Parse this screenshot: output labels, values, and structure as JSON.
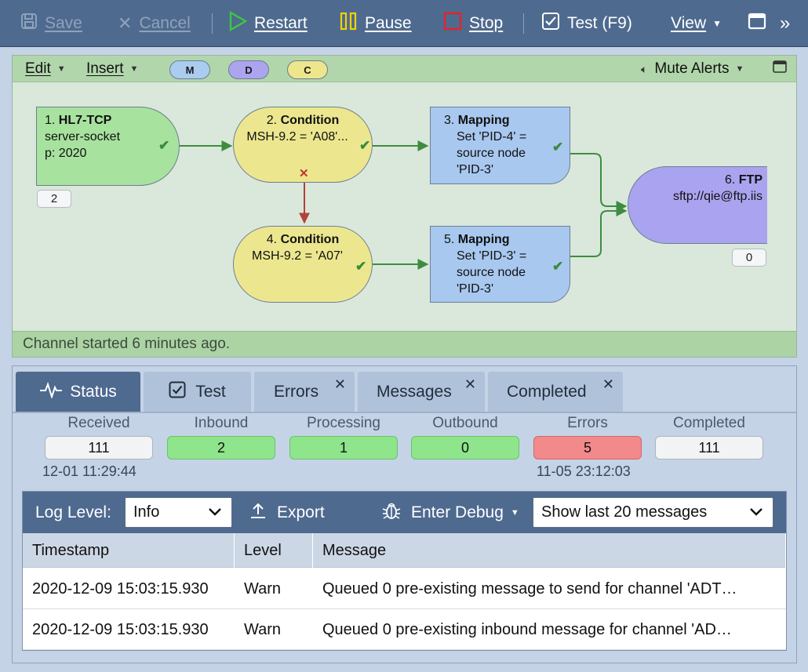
{
  "toolbar": {
    "save": "Save",
    "cancel": "Cancel",
    "restart": "Restart",
    "pause": "Pause",
    "stop": "Stop",
    "test": "Test (F9)",
    "view": "View",
    "icons": {
      "save": "floppy-icon",
      "cancel": "x-icon",
      "restart": "play-icon",
      "pause": "pause-icon",
      "stop": "stop-square-icon",
      "test": "checkbox-icon",
      "window": "window-icon",
      "more": "double-chevron-icon"
    }
  },
  "canvas": {
    "menu_edit": "Edit",
    "menu_insert": "Insert",
    "pills": [
      "M",
      "D",
      "C"
    ],
    "mute_alerts": "Mute Alerts",
    "status_text": "Channel started 6 minutes ago.",
    "nodes": [
      {
        "num": "1.",
        "title": "HL7-TCP",
        "line1": "server-socket",
        "line2": "p: 2020",
        "line3": "",
        "count": "2"
      },
      {
        "num": "2.",
        "title": "Condition",
        "line1": "MSH-9.2 = 'A08'...",
        "line2": "",
        "line3": ""
      },
      {
        "num": "3.",
        "title": "Mapping",
        "line1": "Set 'PID-4' =",
        "line2": "source node",
        "line3": "'PID-3'"
      },
      {
        "num": "4.",
        "title": "Condition",
        "line1": "MSH-9.2 = 'A07'",
        "line2": "",
        "line3": ""
      },
      {
        "num": "5.",
        "title": "Mapping",
        "line1": "Set 'PID-3' =",
        "line2": "source node",
        "line3": "'PID-3'"
      },
      {
        "num": "6.",
        "title": "FTP",
        "line1": "sftp://qie@ftp.iis",
        "line2": "",
        "line3": "",
        "count": "0"
      }
    ],
    "colors": {
      "green": "#a7e29e",
      "yellow": "#ece78f",
      "blue": "#a8c8ef",
      "purple": "#aaa3ef",
      "edge_ok": "#3f8c40",
      "edge_fail": "#b2413a"
    }
  },
  "tabs": [
    {
      "label": "Status",
      "icon": "pulse-icon",
      "active": true
    },
    {
      "label": "Test",
      "icon": "checkbox-icon"
    },
    {
      "label": "Errors",
      "close": "✕"
    },
    {
      "label": "Messages",
      "close": "✕"
    },
    {
      "label": "Completed",
      "close": "✕"
    }
  ],
  "stats": [
    {
      "label": "Received",
      "value": "111",
      "time": "12-01 11:29:44",
      "color": "#f2f3f4"
    },
    {
      "label": "Inbound",
      "value": "2",
      "color": "#8ee58c"
    },
    {
      "label": "Processing",
      "value": "1",
      "color": "#8ee58c"
    },
    {
      "label": "Outbound",
      "value": "0",
      "color": "#8ee58c"
    },
    {
      "label": "Errors",
      "value": "5",
      "time": "11-05 23:12:03",
      "color": "#f2898a"
    },
    {
      "label": "Completed",
      "value": "111",
      "color": "#f2f3f4"
    }
  ],
  "log": {
    "level_label": "Log Level:",
    "level_value": "Info",
    "export": "Export",
    "debug": "Enter Debug",
    "show_value": "Show last 20 messages",
    "columns": [
      "Timestamp",
      "Level",
      "Message"
    ],
    "rows": [
      {
        "timestamp": "2020-12-09 15:03:15.930",
        "level": "Warn",
        "message": "Queued 0 pre-existing message to send for channel 'ADT…"
      },
      {
        "timestamp": "2020-12-09 15:03:15.930",
        "level": "Warn",
        "message": "Queued 0 pre-existing inbound message for channel 'AD…"
      }
    ]
  }
}
